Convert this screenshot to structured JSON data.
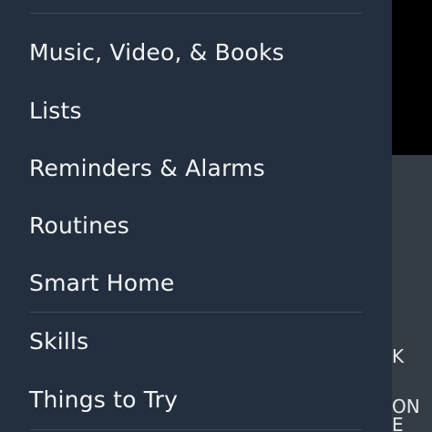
{
  "menu": {
    "items": [
      {
        "label": "Music, Video, & Books"
      },
      {
        "label": "Lists"
      },
      {
        "label": "Reminders & Alarms"
      },
      {
        "label": "Routines"
      },
      {
        "label": "Smart Home"
      },
      {
        "label": "Skills"
      },
      {
        "label": "Things to Try"
      }
    ]
  },
  "background": {
    "fragments": [
      "K",
      "ON",
      "E"
    ]
  },
  "colors": {
    "drawer": "#232f3e",
    "divider": "#3e4a58",
    "text": "#f2f4f6",
    "backdrop_top": "#000000",
    "backdrop_bottom": "#343c44"
  }
}
